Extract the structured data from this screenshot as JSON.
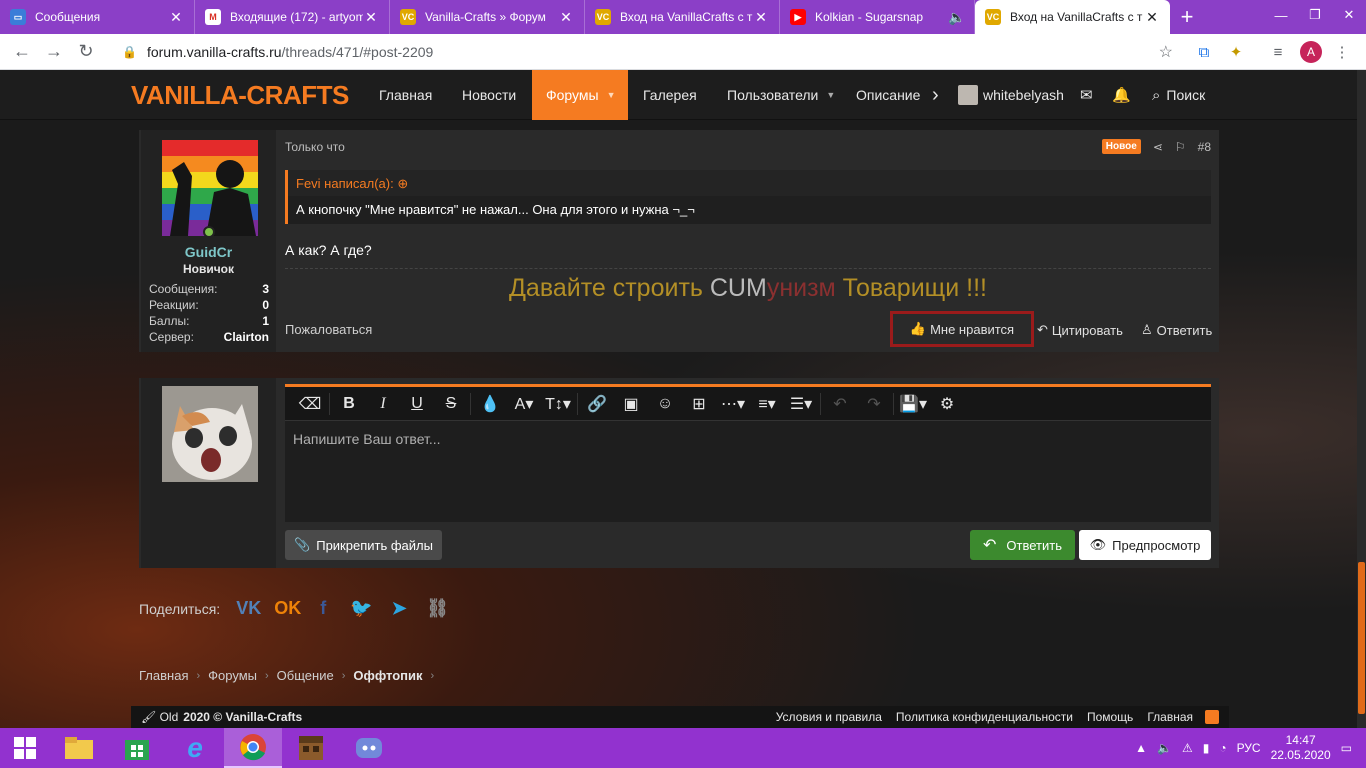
{
  "browser": {
    "tabs": [
      {
        "title": "Сообщения",
        "icon": "chat-icon",
        "color": "#3b7dd8"
      },
      {
        "title": "Входящие (172) - artyom",
        "icon": "gmail-icon",
        "color": "#d93025"
      },
      {
        "title": "Vanilla-Crafts » Форум",
        "icon": "vanilla-crafts-icon",
        "color": "#e0a800"
      },
      {
        "title": "Вход на VanillaCrafts с т",
        "icon": "vanilla-crafts-icon",
        "color": "#e0a800"
      },
      {
        "title": "Kolkian - Sugarsnap",
        "icon": "youtube-icon",
        "color": "#ff0000"
      },
      {
        "title": "Вход на VanillaCrafts с т",
        "icon": "vanilla-crafts-icon",
        "color": "#e0a800"
      }
    ],
    "active_tab": 5,
    "url_host": "forum.vanilla-crafts.ru",
    "url_path": "/threads/471/#post-2209",
    "profile_initial": "A"
  },
  "site": {
    "logo": "VANILLA-CRAFTS",
    "nav": [
      {
        "label": "Главная",
        "caret": false
      },
      {
        "label": "Новости",
        "caret": false
      },
      {
        "label": "Форумы",
        "caret": true
      },
      {
        "label": "Галерея",
        "caret": false
      },
      {
        "label": "Пользователи",
        "caret": true
      },
      {
        "label": "Описание",
        "caret": false
      }
    ],
    "user": "whitebelyash",
    "search": "Поиск",
    "accent": "#f57b21"
  },
  "post": {
    "author": "GuidCr",
    "rank": "Новичок",
    "stats": [
      {
        "k": "Сообщения:",
        "v": "3"
      },
      {
        "k": "Реакции:",
        "v": "0"
      },
      {
        "k": "Баллы:",
        "v": "1"
      },
      {
        "k": "Сервер:",
        "v": "Clairton"
      }
    ],
    "time": "Только что",
    "badge": "Новое",
    "number": "#8",
    "quote_author": "Fevi написал(а):",
    "quote_text": "А кнопочку \"Мне нравится\" не нажал... Она для этого и нужна ¬_¬",
    "text": "А как? А где?",
    "signature": {
      "part1": "Давайте строить ",
      "part2": "CUM",
      "part3": "унизм",
      "part4": " Товарищи !!!"
    },
    "report": "Пожаловаться",
    "like": "Мне нравится",
    "quote_btn": "Цитировать",
    "reply_btn": "Ответить"
  },
  "reply": {
    "placeholder": "Напишите Ваш ответ...",
    "attach": "Прикрепить файлы",
    "submit": "Ответить",
    "preview": "Предпросмотр"
  },
  "share": {
    "label": "Поделиться:",
    "icons": [
      "vk-icon",
      "odnoklassniki-icon",
      "facebook-icon",
      "twitter-icon",
      "telegram-icon",
      "link-icon"
    ]
  },
  "breadcrumbs": [
    "Главная",
    "Форумы",
    "Общение",
    "Оффтопик"
  ],
  "footer": {
    "style": "Old",
    "copyright": "2020 © Vanilla-Crafts",
    "links": [
      "Условия и правила",
      "Политика конфиденциальности",
      "Помощь",
      "Главная"
    ]
  },
  "taskbar": {
    "lang": "РУС",
    "time": "14:47",
    "date": "22.05.2020"
  }
}
